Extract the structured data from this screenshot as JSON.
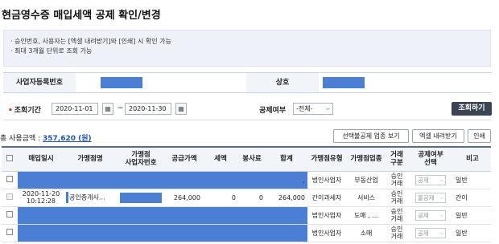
{
  "page": {
    "title": "현금영수증 매입세액 공제 확인/변경"
  },
  "info": {
    "lines": [
      "· 승인번호, 사용자는 [엑셀 내려받기]와 [인쇄] 시 확인 가능",
      "· 최대 3개월 단위로 조회 가능"
    ]
  },
  "biz": {
    "reg_label": "사업자등록번호",
    "name_label": "상호"
  },
  "search": {
    "period_label": "조회기간",
    "date_from": "2020-11-01",
    "date_to": "2020-11-30",
    "tilde": "~",
    "deduction_label": "공제여부",
    "deduction_value": "-전체-",
    "search_button": "조회하기",
    "calendar_icon_glyph": "▦",
    "required_marker": "•"
  },
  "summary": {
    "label": "총 사용금액 :",
    "amount": "357,620 (원)"
  },
  "toolbar": {
    "compare_button": "선택불공제 업종 보기",
    "excel_button": "엑셀 내려받기",
    "print_button": "인쇄"
  },
  "table": {
    "headers": {
      "date": "매입일시",
      "merchant": "가맹점명",
      "merchant_reg": "가맹점\n사업자번호",
      "supply": "공급가액",
      "tax": "세액",
      "service": "봉사료",
      "total": "합계",
      "merchant_type": "가맹점유형",
      "industry": "가맹점업종",
      "trade": "거래\n구분",
      "deduct": "공제여부\n선택",
      "note": "비고"
    },
    "rows": [
      {
        "date": "",
        "merchant": "",
        "merchant_reg": "",
        "supply": "",
        "tax": "",
        "service": "",
        "total": ",",
        "merchant_type": "법인사업자",
        "industry": "부동산업",
        "trade": "승인\n거래",
        "deduct": "공제",
        "note": "일반"
      },
      {
        "date": "2020-11-20\n10:12:28",
        "merchant": "공인중개사…",
        "merchant_reg": "",
        "supply": "264,000",
        "tax": "0",
        "service": "0",
        "total": "264,000",
        "merchant_type": "간이과세자",
        "industry": "서비스",
        "trade": "승인\n거래",
        "deduct": "불공제",
        "note": "간이"
      },
      {
        "date": "",
        "merchant": "",
        "merchant_reg": "",
        "supply": "",
        "tax": "",
        "service": "",
        "total": "",
        "merchant_type": "법인사업자",
        "industry": "도매 , …",
        "trade": "승인\n거래",
        "deduct": "공제",
        "note": "일반"
      },
      {
        "date": "",
        "merchant": "",
        "merchant_reg": "",
        "supply": "",
        "tax": "",
        "service": "",
        "total": "",
        "merchant_type": "법인사업자",
        "industry": "소매",
        "trade": "승인\n거래",
        "deduct": "공제",
        "note": "일반"
      }
    ],
    "dropdown_arrow": "⌵"
  },
  "colors": {
    "mask": "#4a7fd4",
    "accent_link": "#1f56b8",
    "dark_button": "#3a4452",
    "required": "#dd2222"
  }
}
